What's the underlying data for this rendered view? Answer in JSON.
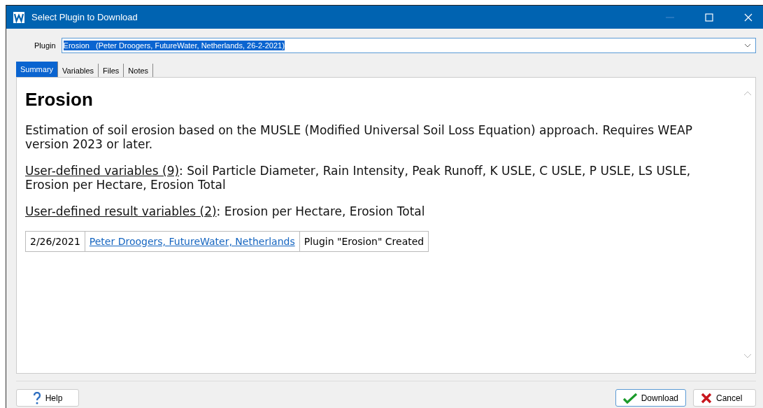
{
  "window": {
    "title": "Select Plugin to Download"
  },
  "plugin": {
    "label": "Plugin",
    "value": "Erosion   (Peter Droogers, FutureWater, Netherlands, 26-2-2021)"
  },
  "tabs": [
    {
      "label": "Summary",
      "selected": true
    },
    {
      "label": "Variables",
      "selected": false
    },
    {
      "label": "Files",
      "selected": false
    },
    {
      "label": "Notes",
      "selected": false
    }
  ],
  "summary": {
    "heading": "Erosion",
    "description": "Estimation of soil erosion based on the MUSLE (Modified Universal Soil Loss Equation) approach. Requires WEAP version 2023 or later.",
    "sections": [
      {
        "label": "User-defined variables (9)",
        "text": ": Soil Particle Diameter, Rain Intensity, Peak Runoff, K USLE, C USLE, P USLE, LS USLE, Erosion per Hectare, Erosion Total"
      },
      {
        "label": "User-defined result variables (2)",
        "text": ": Erosion per Hectare, Erosion Total"
      }
    ],
    "history": [
      {
        "date": "2/26/2021",
        "author": "Peter Droogers, FutureWater, Netherlands",
        "note": "Plugin \"Erosion\" Created"
      }
    ]
  },
  "buttons": {
    "help": "Help",
    "download": "Download",
    "cancel": "Cancel"
  }
}
